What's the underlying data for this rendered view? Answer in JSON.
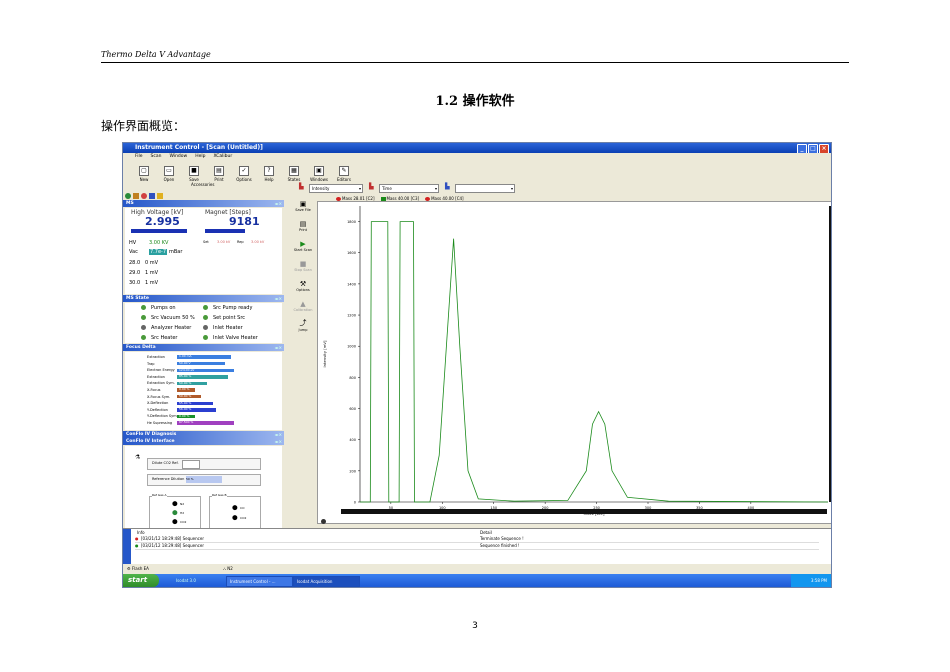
{
  "doc": {
    "header": "Thermo Delta V Advantage",
    "section": "1.2  操作软件",
    "intro": "操作界面概览：",
    "page_number": "3"
  },
  "app": {
    "window_title": "Instrument Control - [Scan (Untitled)]",
    "menu": [
      "File",
      "Scan",
      "Window",
      "Help",
      "XCalibur"
    ],
    "toolbar": [
      "New",
      "Open",
      "Save",
      "Print",
      "Options",
      "Help",
      "States",
      "Windows",
      "Editors"
    ],
    "accessories_label": "Accessories",
    "ms": {
      "header": "MS",
      "hv_label": "High Voltage [kV]",
      "hv_value": "2.995",
      "magnet_label": "Magnet [Steps]",
      "magnet_value": "9181",
      "hv_row_label": "HV",
      "hv_row_value": "3.00 KV",
      "hv_extra": [
        "Set",
        "3.00 kV",
        "Rep",
        "3.00 kV"
      ],
      "vac_label": "Vac",
      "vac_value": "7.7e-7",
      "vac_unit": "mBar",
      "mass_rows": [
        {
          "mass": "28.0",
          "value": "0 mV"
        },
        {
          "mass": "29.0",
          "value": "1 mV"
        },
        {
          "mass": "30.0",
          "value": "1 mV"
        }
      ]
    },
    "ms_state": {
      "header": "MS State",
      "items": [
        "Pumps on",
        "Src Pump ready",
        "Src Vacuum 50 %",
        "Set point Src",
        "Analyzer Heater",
        "Inlet Heater",
        "Src Heater",
        "Inlet Valve Heater"
      ]
    },
    "focus": {
      "header": "Focus Delta",
      "rows": [
        {
          "label": "Extraction",
          "value": "1.00 mA",
          "color": "#3b7fe0",
          "frac": 0.9
        },
        {
          "label": "Trap",
          "value": "50.00 V",
          "color": "#3b7fe0",
          "frac": 0.8
        },
        {
          "label": "Electron Energy",
          "value": "124.00 eV",
          "color": "#3b7fe0",
          "frac": 0.95
        },
        {
          "label": "Extraction",
          "value": "85.00 %",
          "color": "#30a0a0",
          "frac": 0.85
        },
        {
          "label": "Extraction Sym.",
          "value": "50.00 %",
          "color": "#30a0a0",
          "frac": 0.5
        },
        {
          "label": "X-Focus",
          "value": "0.00 %",
          "color": "#b05a2a",
          "frac": 0.3
        },
        {
          "label": "X-Focus Sym.",
          "value": "50.00 %",
          "color": "#b05a2a",
          "frac": 0.4
        },
        {
          "label": "X-Deflection",
          "value": "55.00 %",
          "color": "#2b3fd0",
          "frac": 0.6
        },
        {
          "label": "Y-Deflection",
          "value": "56.00 %",
          "color": "#2b3fd0",
          "frac": 0.65
        },
        {
          "label": "Y-Deflection Sym.",
          "value": "0.00 %",
          "color": "#1a8f2a",
          "frac": 0.3
        },
        {
          "label": "He Supressing",
          "value": "67.500 %",
          "color": "#a040c0",
          "frac": 0.95
        }
      ]
    },
    "conflo_diag": "ConFlo IV Diagnosis",
    "conflo_iface": "ConFlo IV Interface",
    "conflo": {
      "dilute": "Dilute CO2 Ref.",
      "ref_label": "Reference Dilution",
      "ref_value": "50 %",
      "ref_gas_a": "Ref Gas A",
      "ref_gas_b": "Ref Gas B",
      "gas_a": [
        "N2",
        "H2",
        "CO2"
      ],
      "gas_b": [
        "CO",
        "CO2"
      ],
      "on_off": "On/Off"
    },
    "side_tools": [
      "Save File",
      "Print",
      "Start Scan",
      "Stop Scan",
      "Options",
      "Calibration",
      "Jump"
    ],
    "chart_controls": {
      "y_select": "Intensity",
      "x_select": "Time",
      "extra_select": ""
    }
  },
  "chart_data": {
    "type": "line",
    "ylabel": "Intensity [mV]",
    "xlabel": "Clock [sec]",
    "xlim": [
      20,
      475
    ],
    "ylim": [
      0,
      1900
    ],
    "x_ticks": [
      50,
      100,
      150,
      200,
      250,
      300,
      350,
      400
    ],
    "y_ticks": [
      0,
      200,
      400,
      600,
      800,
      1000,
      1200,
      1400,
      1600,
      1800
    ],
    "series": [
      {
        "name": "Mass 28.01 [C2]",
        "color": "#d42020",
        "values": []
      },
      {
        "name": "Mass 40.00 [C3]",
        "color": "#1a8a1a",
        "values": [
          [
            20,
            0
          ],
          [
            30,
            0
          ],
          [
            31,
            1800
          ],
          [
            47,
            1800
          ],
          [
            48,
            0
          ],
          [
            58,
            0
          ],
          [
            59,
            1800
          ],
          [
            72,
            1800
          ],
          [
            73,
            0
          ],
          [
            88,
            0
          ],
          [
            97,
            300
          ],
          [
            104,
            1000
          ],
          [
            111,
            1690
          ],
          [
            117,
            1000
          ],
          [
            125,
            200
          ],
          [
            135,
            20
          ],
          [
            170,
            5
          ],
          [
            222,
            10
          ],
          [
            240,
            200
          ],
          [
            246,
            500
          ],
          [
            252,
            580
          ],
          [
            258,
            500
          ],
          [
            265,
            200
          ],
          [
            280,
            30
          ],
          [
            320,
            5
          ],
          [
            475,
            0
          ]
        ]
      },
      {
        "name": "Mass 40.00 [C4]",
        "color": "#d42020",
        "values": []
      }
    ]
  },
  "log": {
    "col_info": "Info",
    "col_detail": "Detail",
    "rows": [
      {
        "info": "[03/21/12 18:29:48] Sequencer",
        "detail": "Terminate Sequence !"
      },
      {
        "info": "[03/21/12 18:29:48] Sequencer",
        "detail": "Sequence finished !"
      }
    ]
  },
  "statusbar": {
    "flash": "Flash EA",
    "gas": "N2"
  },
  "taskbar": {
    "start": "start",
    "tasks": [
      "Isodat 3.0",
      "Instrument Control - ...",
      "Isodat Acquisition"
    ],
    "time": "3:58 PM"
  }
}
